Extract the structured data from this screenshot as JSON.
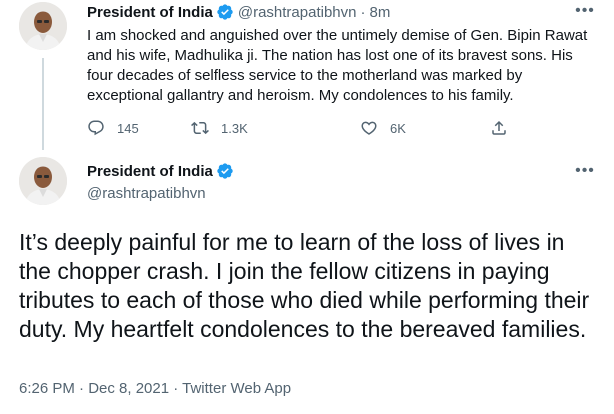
{
  "tweet1": {
    "author_name": "President of India",
    "handle": "@rashtrapatibhvn",
    "separator": "·",
    "time_ago": "8m",
    "more_label": "•••",
    "text": "I am shocked and anguished over the untimely demise of Gen. Bipin Rawat and his wife, Madhulika ji. The nation has lost one of its bravest sons. His four decades of selfless service to the motherland was marked by exceptional gallantry and heroism. My condolences to his family.",
    "actions": {
      "replies": "145",
      "retweets": "1.3K",
      "likes": "6K"
    }
  },
  "tweet2": {
    "author_name": "President of India",
    "handle": "@rashtrapatibhvn",
    "more_label": "•••",
    "text": "It’s deeply painful for me to learn of the loss of lives in the chopper crash. I join the fellow citizens in paying tributes to each of those who died while performing their duty. My heartfelt condolences to the bereaved families.",
    "meta": "6:26 PM · Dec 8, 2021 · Twitter Web App"
  },
  "colors": {
    "verified": "#1d9bf0",
    "secondary_text": "#536471",
    "thread_line": "#cfd9de"
  },
  "icons": [
    "reply-icon",
    "retweet-icon",
    "like-icon",
    "share-icon",
    "verified-badge-icon",
    "more-icon"
  ]
}
